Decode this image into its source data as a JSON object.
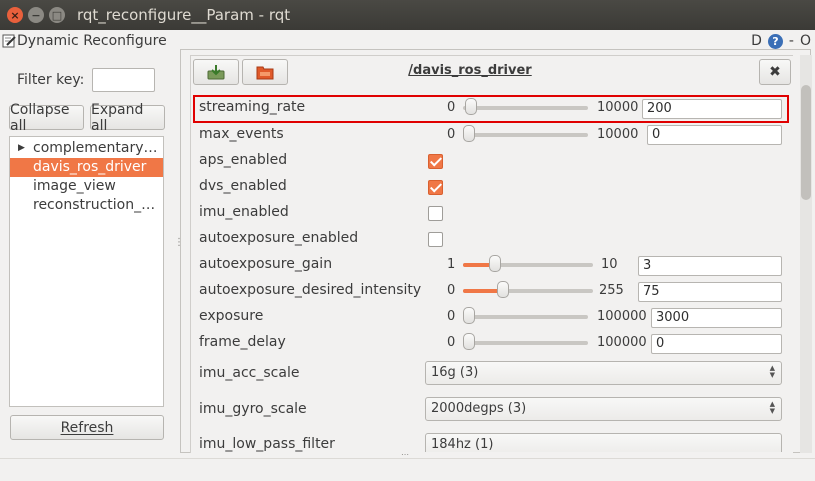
{
  "window": {
    "title": "rqt_reconfigure__Param - rqt",
    "close_glyph": "×",
    "minimize_glyph": "−",
    "maximize_glyph": "□"
  },
  "plugin": {
    "title": "Dynamic Reconfigure",
    "ctrl_d": "D",
    "help_glyph": "?",
    "ctrl_minus": "-",
    "ctrl_o": "O"
  },
  "sidebar": {
    "filter_label": "Filter key:",
    "filter_value": "",
    "collapse_label": "Collapse all",
    "expand_label": "Expand all",
    "refresh_label": "Refresh",
    "splitter_glyph": "⋮",
    "items": [
      {
        "label": "complementary…",
        "expandable": true,
        "selected": false
      },
      {
        "label": "davis_ros_driver",
        "expandable": false,
        "selected": true
      },
      {
        "label": "image_view",
        "expandable": false,
        "selected": false
      },
      {
        "label": "reconstruction_…",
        "expandable": false,
        "selected": false
      }
    ]
  },
  "node": {
    "title": "/davis_ros_driver",
    "load_icon": "load-icon",
    "save_icon": "save-icon",
    "close_glyph": "✖"
  },
  "params": {
    "streaming_rate": {
      "name": "streaming_rate",
      "min": "0",
      "max": "10000",
      "value": "200",
      "fraction": 0.02
    },
    "max_events": {
      "name": "max_events",
      "min": "0",
      "max": "10000",
      "value": "0",
      "fraction": 0.0
    },
    "aps_enabled": {
      "name": "aps_enabled",
      "checked": true
    },
    "dvs_enabled": {
      "name": "dvs_enabled",
      "checked": true
    },
    "imu_enabled": {
      "name": "imu_enabled",
      "checked": false
    },
    "autoexposure_enabled": {
      "name": "autoexposure_enabled",
      "checked": false
    },
    "autoexposure_gain": {
      "name": "autoexposure_gain",
      "min": "1",
      "max": "10",
      "value": "3",
      "fraction": 0.22
    },
    "autoexposure_desired_intensity": {
      "name": "autoexposure_desired_intensity",
      "min": "0",
      "max": "255",
      "value": "75",
      "fraction": 0.29
    },
    "exposure": {
      "name": "exposure",
      "min": "0",
      "max": "1000000",
      "value": "3000",
      "fraction": 0.003
    },
    "frame_delay": {
      "name": "frame_delay",
      "min": "0",
      "max": "1000000",
      "value": "0",
      "fraction": 0.0
    },
    "imu_acc_scale": {
      "name": "imu_acc_scale",
      "value": "16g (3)"
    },
    "imu_gyro_scale": {
      "name": "imu_gyro_scale",
      "value": "2000degps (3)"
    },
    "imu_low_pass_filter": {
      "name": "imu_low_pass_filter",
      "value": "184hz (1)"
    }
  },
  "colors": {
    "accent": "#f07746",
    "highlight": "#e00000"
  }
}
